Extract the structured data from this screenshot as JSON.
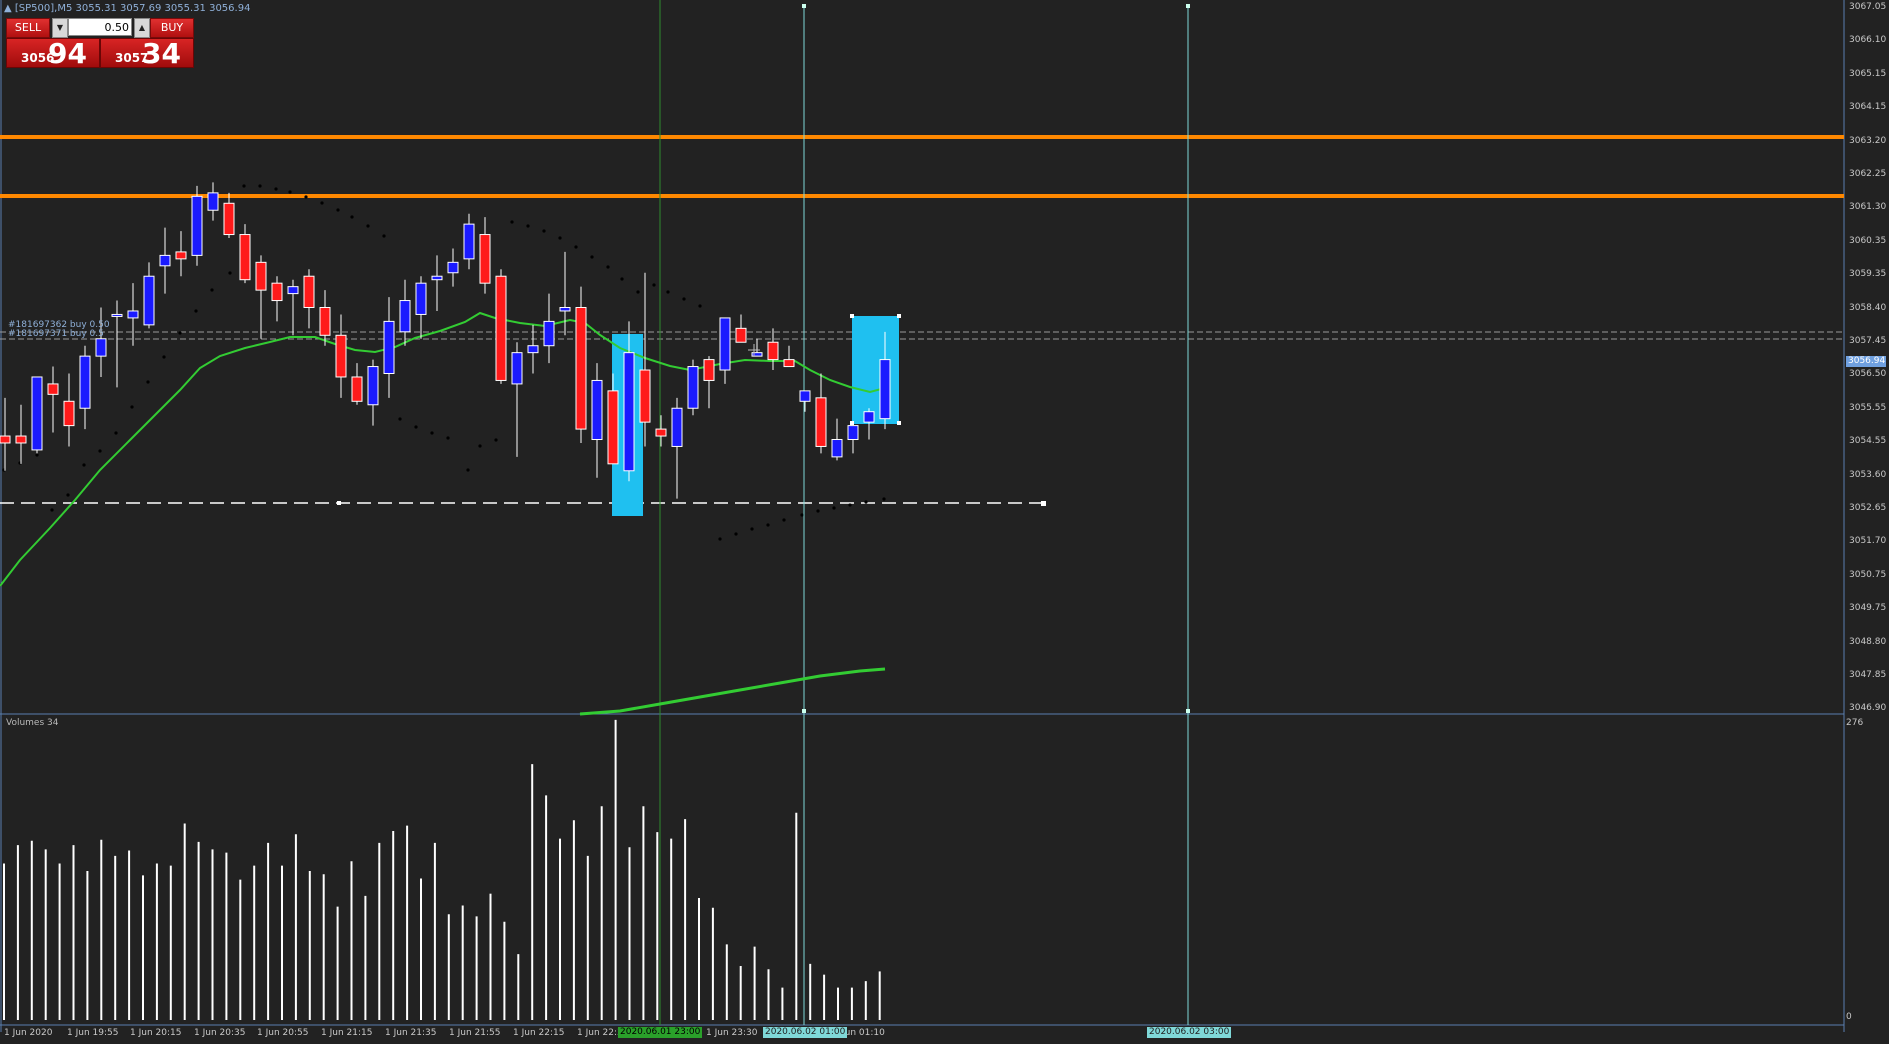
{
  "header": {
    "title": "▲ [SP500],M5  3055.31 3057.69 3055.31 3056.94"
  },
  "trade_panel": {
    "sell_label": "SELL",
    "buy_label": "BUY",
    "lot": "0.50",
    "sell_price_small": "3056",
    "sell_price_big": "94",
    "buy_price_small": "3057",
    "buy_price_big": "34"
  },
  "orders": [
    {
      "text": "#181697362 buy 0.50"
    },
    {
      "text": "#181697371 buy 0.5"
    }
  ],
  "volumes_title": "Volumes 34",
  "price_axis": {
    "ticks": [
      "3067.05",
      "3066.10",
      "3065.15",
      "3064.15",
      "3063.20",
      "3062.25",
      "3061.30",
      "3060.35",
      "3059.35",
      "3058.40",
      "3057.45",
      "3056.50",
      "3055.55",
      "3054.55",
      "3053.60",
      "3052.65",
      "3051.70",
      "3050.75",
      "3049.75",
      "3048.80",
      "3047.85",
      "3046.90"
    ],
    "current": "3056.94"
  },
  "volume_axis": {
    "max": "276",
    "min": "0"
  },
  "time_axis": {
    "ticks": [
      "1 Jun 2020",
      "1 Jun 19:55",
      "1 Jun 20:15",
      "1 Jun 20:35",
      "1 Jun 20:55",
      "1 Jun 21:15",
      "1 Jun 21:35",
      "1 Jun 21:55",
      "1 Jun 22:15",
      "1 Jun 22:3",
      "1 Jun 23:30",
      "Jun 01:10"
    ],
    "marker_1": "2020.06.01 23:00",
    "marker_2": "2020.06.02 01:00",
    "marker_3": "2020.06.02 03:00"
  },
  "colors": {
    "background": "#222222",
    "bull": "#1a1aff",
    "bear": "#ff1a1a",
    "ma_fast": "#33cc33",
    "hline": "#ff8800",
    "vline": "#7fd8d8",
    "selection": "#1fc0f0"
  },
  "chart_data": {
    "type": "candlestick",
    "symbol": "[SP500]",
    "timeframe": "M5",
    "ylim": [
      3046.9,
      3067.05
    ],
    "candles": [
      {
        "o": 3054.7,
        "h": 3055.8,
        "l": 3053.7,
        "c": 3054.5
      },
      {
        "o": 3054.7,
        "h": 3055.6,
        "l": 3053.9,
        "c": 3054.5
      },
      {
        "o": 3054.3,
        "h": 3056.4,
        "l": 3054.2,
        "c": 3056.4
      },
      {
        "o": 3056.2,
        "h": 3056.7,
        "l": 3054.8,
        "c": 3055.9
      },
      {
        "o": 3055.7,
        "h": 3056.5,
        "l": 3054.4,
        "c": 3055.0
      },
      {
        "o": 3055.5,
        "h": 3057.3,
        "l": 3054.9,
        "c": 3057.0
      },
      {
        "o": 3057.0,
        "h": 3058.4,
        "l": 3056.4,
        "c": 3057.5
      },
      {
        "o": 3058.2,
        "h": 3058.6,
        "l": 3056.1,
        "c": 3058.2
      },
      {
        "o": 3058.1,
        "h": 3059.1,
        "l": 3057.3,
        "c": 3058.3
      },
      {
        "o": 3057.9,
        "h": 3059.7,
        "l": 3057.8,
        "c": 3059.3
      },
      {
        "o": 3059.6,
        "h": 3060.7,
        "l": 3058.8,
        "c": 3059.9
      },
      {
        "o": 3060.0,
        "h": 3060.6,
        "l": 3059.3,
        "c": 3059.8
      },
      {
        "o": 3059.9,
        "h": 3061.9,
        "l": 3059.6,
        "c": 3061.6
      },
      {
        "o": 3061.2,
        "h": 3062.0,
        "l": 3060.9,
        "c": 3061.7
      },
      {
        "o": 3061.4,
        "h": 3061.7,
        "l": 3060.4,
        "c": 3060.5
      },
      {
        "o": 3060.5,
        "h": 3060.8,
        "l": 3059.1,
        "c": 3059.2
      },
      {
        "o": 3059.7,
        "h": 3059.9,
        "l": 3057.5,
        "c": 3058.9
      },
      {
        "o": 3059.1,
        "h": 3059.3,
        "l": 3058.0,
        "c": 3058.6
      },
      {
        "o": 3058.8,
        "h": 3059.2,
        "l": 3057.6,
        "c": 3059.0
      },
      {
        "o": 3059.3,
        "h": 3059.5,
        "l": 3057.8,
        "c": 3058.4
      },
      {
        "o": 3058.4,
        "h": 3058.9,
        "l": 3057.3,
        "c": 3057.6
      },
      {
        "o": 3057.6,
        "h": 3058.2,
        "l": 3055.8,
        "c": 3056.4
      },
      {
        "o": 3056.4,
        "h": 3056.8,
        "l": 3055.6,
        "c": 3055.7
      },
      {
        "o": 3055.6,
        "h": 3056.9,
        "l": 3055.0,
        "c": 3056.7
      },
      {
        "o": 3056.5,
        "h": 3058.7,
        "l": 3055.8,
        "c": 3058.0
      },
      {
        "o": 3057.7,
        "h": 3059.2,
        "l": 3057.3,
        "c": 3058.6
      },
      {
        "o": 3058.2,
        "h": 3059.3,
        "l": 3057.5,
        "c": 3059.1
      },
      {
        "o": 3059.2,
        "h": 3059.9,
        "l": 3058.3,
        "c": 3059.3
      },
      {
        "o": 3059.4,
        "h": 3060.1,
        "l": 3059.0,
        "c": 3059.7
      },
      {
        "o": 3059.8,
        "h": 3061.1,
        "l": 3059.5,
        "c": 3060.8
      },
      {
        "o": 3060.5,
        "h": 3061.0,
        "l": 3058.8,
        "c": 3059.1
      },
      {
        "o": 3059.3,
        "h": 3059.5,
        "l": 3056.2,
        "c": 3056.3
      },
      {
        "o": 3056.2,
        "h": 3057.4,
        "l": 3054.1,
        "c": 3057.1
      },
      {
        "o": 3057.1,
        "h": 3057.9,
        "l": 3056.5,
        "c": 3057.3
      },
      {
        "o": 3057.3,
        "h": 3058.8,
        "l": 3056.8,
        "c": 3058.0
      },
      {
        "o": 3058.3,
        "h": 3060.0,
        "l": 3057.6,
        "c": 3058.4
      },
      {
        "o": 3058.4,
        "h": 3059.0,
        "l": 3054.5,
        "c": 3054.9
      },
      {
        "o": 3054.6,
        "h": 3056.8,
        "l": 3053.5,
        "c": 3056.3
      },
      {
        "o": 3056.0,
        "h": 3056.5,
        "l": 3053.9,
        "c": 3053.9
      },
      {
        "o": 3053.7,
        "h": 3058.0,
        "l": 3053.4,
        "c": 3057.1
      },
      {
        "o": 3056.6,
        "h": 3059.4,
        "l": 3054.4,
        "c": 3055.1
      },
      {
        "o": 3054.9,
        "h": 3055.3,
        "l": 3054.4,
        "c": 3054.7
      },
      {
        "o": 3054.4,
        "h": 3055.8,
        "l": 3052.9,
        "c": 3055.5
      },
      {
        "o": 3055.5,
        "h": 3056.9,
        "l": 3055.3,
        "c": 3056.7
      },
      {
        "o": 3056.9,
        "h": 3057.0,
        "l": 3055.5,
        "c": 3056.3
      },
      {
        "o": 3056.6,
        "h": 3058.1,
        "l": 3056.2,
        "c": 3058.1
      },
      {
        "o": 3057.8,
        "h": 3058.2,
        "l": 3057.4,
        "c": 3057.4
      },
      {
        "o": 3057.0,
        "h": 3057.5,
        "l": 3057.0,
        "c": 3057.1
      },
      {
        "o": 3057.4,
        "h": 3057.8,
        "l": 3056.6,
        "c": 3056.9
      },
      {
        "o": 3056.9,
        "h": 3057.3,
        "l": 3056.7,
        "c": 3056.7
      },
      {
        "o": 3055.7,
        "h": 3056.0,
        "l": 3055.4,
        "c": 3056.0
      },
      {
        "o": 3055.8,
        "h": 3056.5,
        "l": 3054.2,
        "c": 3054.4
      },
      {
        "o": 3054.1,
        "h": 3055.2,
        "l": 3054.0,
        "c": 3054.6
      },
      {
        "o": 3054.6,
        "h": 3055.0,
        "l": 3054.2,
        "c": 3055.0
      },
      {
        "o": 3055.1,
        "h": 3055.5,
        "l": 3054.6,
        "c": 3055.4
      },
      {
        "o": 3055.2,
        "h": 3057.7,
        "l": 3054.9,
        "c": 3056.9
      }
    ],
    "volumes": [
      145,
      162,
      166,
      158,
      145,
      162,
      138,
      167,
      152,
      157,
      134,
      145,
      143,
      182,
      165,
      158,
      155,
      130,
      143,
      164,
      143,
      172,
      138,
      135,
      105,
      147,
      115,
      164,
      175,
      180,
      131,
      164,
      98,
      106,
      96,
      117,
      91,
      61,
      237,
      208,
      168,
      185,
      152,
      198,
      278,
      160,
      198,
      174,
      168,
      186,
      113,
      104,
      70,
      50,
      68,
      47,
      30,
      192,
      52,
      42,
      30,
      30,
      36,
      45
    ]
  }
}
